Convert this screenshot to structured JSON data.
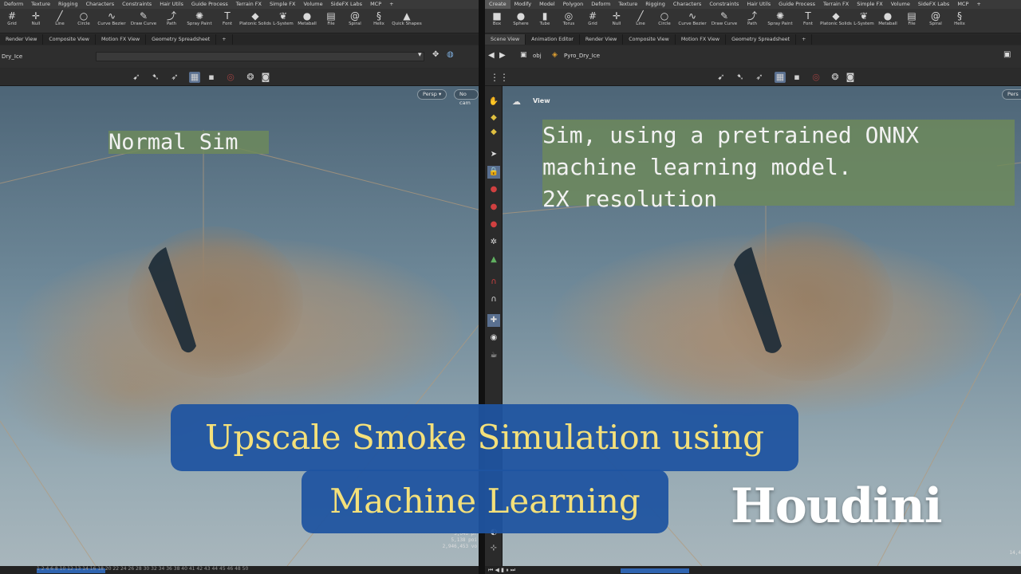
{
  "left": {
    "menu": [
      "Deform",
      "Texture",
      "Rigging",
      "Characters",
      "Constraints",
      "Hair Utils",
      "Guide Process",
      "Terrain FX",
      "Simple FX",
      "Volume",
      "SideFX Labs",
      "MCP",
      "+"
    ],
    "shelf": [
      {
        "label": "Grid",
        "icon": "grid-icon"
      },
      {
        "label": "Null",
        "icon": "null-icon"
      },
      {
        "label": "Line",
        "icon": "line-icon"
      },
      {
        "label": "Circle",
        "icon": "circle-icon"
      },
      {
        "label": "Curve Bezier",
        "icon": "curve-bezier-icon"
      },
      {
        "label": "Draw Curve",
        "icon": "draw-curve-icon"
      },
      {
        "label": "Path",
        "icon": "path-icon"
      },
      {
        "label": "Spray Paint",
        "icon": "spray-paint-icon"
      },
      {
        "label": "Font",
        "icon": "font-icon"
      },
      {
        "label": "Platonic Solids",
        "icon": "platonic-solids-icon"
      },
      {
        "label": "L-System",
        "icon": "l-system-icon"
      },
      {
        "label": "Metaball",
        "icon": "metaball-icon"
      },
      {
        "label": "File",
        "icon": "file-icon"
      },
      {
        "label": "Spiral",
        "icon": "spiral-icon"
      },
      {
        "label": "Helix",
        "icon": "helix-icon"
      },
      {
        "label": "Quick Shapes",
        "icon": "quick-shapes-icon"
      }
    ],
    "tabs": [
      "Render View",
      "Composite View",
      "Motion FX View",
      "Geometry Spreadsheet",
      "+"
    ],
    "path": "Dry_Ice",
    "persp": "Persp ▾",
    "cam": "No cam",
    "overlay_text": "Normal Sim",
    "stats": [
      "5,046 pr",
      "5,138 poi",
      "2,946,453 vo"
    ],
    "timeline": "1  2  4  6  8  10  12  13  14  16  18  20  22  24  26  28  30  32  34  36  38  40  41  42  43  44  45  46  48  50"
  },
  "right": {
    "menu": [
      "Create",
      "Modify",
      "Model",
      "Polygon",
      "Deform",
      "Texture",
      "Rigging",
      "Characters",
      "Constraints",
      "Hair Utils",
      "Guide Process",
      "Terrain FX",
      "Simple FX",
      "Volume",
      "SideFX Labs",
      "MCP",
      "+"
    ],
    "shelf": [
      {
        "label": "Box",
        "icon": "box-icon"
      },
      {
        "label": "Sphere",
        "icon": "sphere-icon"
      },
      {
        "label": "Tube",
        "icon": "tube-icon"
      },
      {
        "label": "Torus",
        "icon": "torus-icon"
      },
      {
        "label": "Grid",
        "icon": "grid-icon"
      },
      {
        "label": "Null",
        "icon": "null-icon"
      },
      {
        "label": "Line",
        "icon": "line-icon"
      },
      {
        "label": "Circle",
        "icon": "circle-icon"
      },
      {
        "label": "Curve Bezier",
        "icon": "curve-bezier-icon"
      },
      {
        "label": "Draw Curve",
        "icon": "draw-curve-icon"
      },
      {
        "label": "Path",
        "icon": "path-icon"
      },
      {
        "label": "Spray Paint",
        "icon": "spray-paint-icon"
      },
      {
        "label": "Font",
        "icon": "font-icon"
      },
      {
        "label": "Platonic Solids",
        "icon": "platonic-solids-icon"
      },
      {
        "label": "L-System",
        "icon": "l-system-icon"
      },
      {
        "label": "Metaball",
        "icon": "metaball-icon"
      },
      {
        "label": "File",
        "icon": "file-icon"
      },
      {
        "label": "Spiral",
        "icon": "spiral-icon"
      },
      {
        "label": "Helix",
        "icon": "helix-icon"
      }
    ],
    "tabs": [
      "Scene View",
      "Animation Editor",
      "Render View",
      "Composite View",
      "Motion FX View",
      "Geometry Spreadsheet",
      "+"
    ],
    "path_obj": "obj",
    "path_node": "Pyro_Dry_Ice",
    "view_label": "View",
    "persp": "Pers",
    "overlay_text": "Sim, using a pretrained ONNX\nmachine learning model.\n2X resolution",
    "stats": [
      "14,4"
    ]
  },
  "title": {
    "line1": "Upscale Smoke Simulation using",
    "line2": "Machine Learning",
    "brand": "Houdini"
  },
  "colors": {
    "title_bg": "#1f54a0",
    "title_text": "#f4e07a",
    "overlay_bg": "#6e8a5a",
    "timeline_bar": "#2f64b0"
  }
}
